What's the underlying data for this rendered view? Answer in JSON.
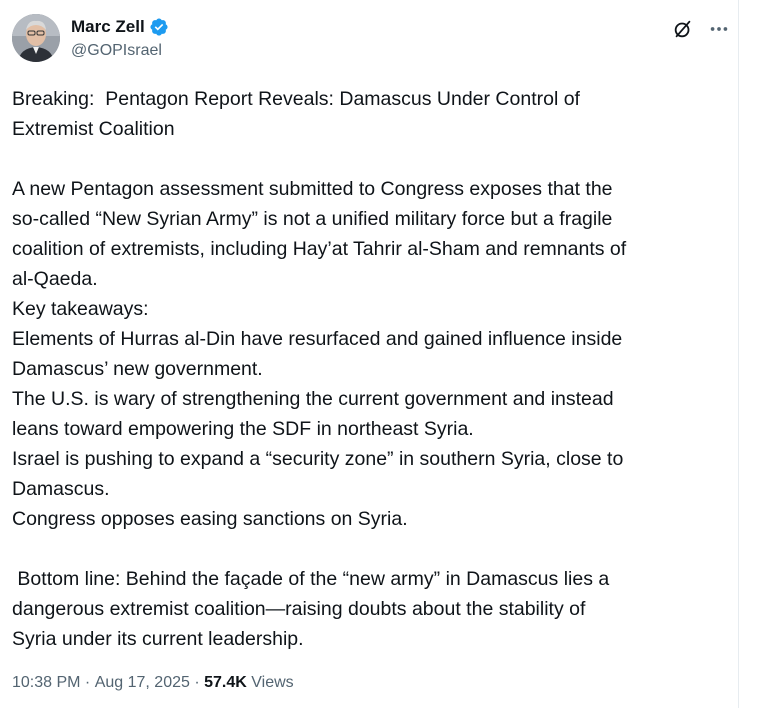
{
  "author": {
    "display_name": "Marc Zell",
    "handle": "@GOPIsrael",
    "verified": true,
    "avatar_icon": "profile-photo"
  },
  "header_icons": {
    "grok_icon": "slashed-circle-icon",
    "more_icon": "more-horizontal-icon"
  },
  "tweet": {
    "text": "Breaking:  Pentagon Report Reveals: Damascus Under Control of\nExtremist Coalition\n\nA new Pentagon assessment submitted to Congress exposes that the\nso-called “New Syrian Army” is not a unified military force but a fragile\ncoalition of extremists, including Hay’at Tahrir al-Sham and remnants of\nal-Qaeda.\nKey takeaways:\nElements of Hurras al-Din have resurfaced and gained influence inside\nDamascus’ new government.\nThe U.S. is wary of strengthening the current government and instead\nleans toward empowering the SDF in northeast Syria.\nIsrael is pushing to expand a “security zone” in southern Syria, close to\nDamascus.\nCongress opposes easing sanctions on Syria.\n\n Bottom line: Behind the façade of the “new army” in Damascus lies a\ndangerous extremist coalition—raising doubts about the stability of\nSyria under its current leadership."
  },
  "meta": {
    "time": "10:38 PM",
    "separator": " · ",
    "date": "Aug 17, 2025",
    "views_count": "57.4K",
    "views_label": " Views"
  },
  "colors": {
    "text_primary": "#0f1419",
    "text_secondary": "#536471",
    "verified_blue": "#1d9bf0"
  }
}
